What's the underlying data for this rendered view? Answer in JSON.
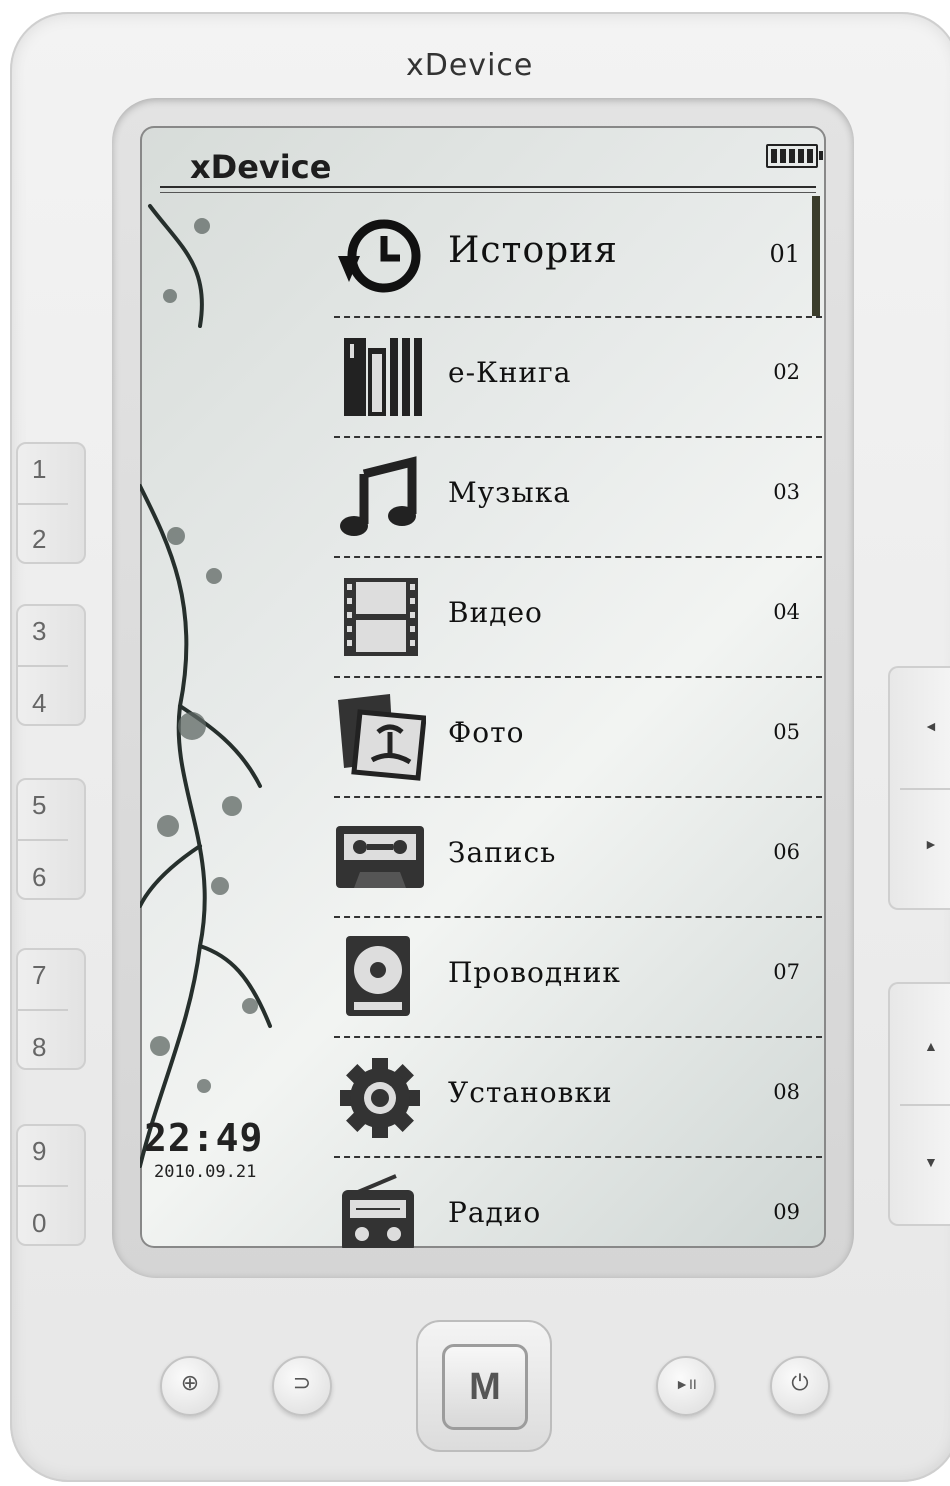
{
  "device": {
    "brand": "xDevice"
  },
  "status": {
    "brand": "xDevice",
    "battery": "battery-full-icon"
  },
  "clock": {
    "time": "22:49",
    "date": "2010.09.21"
  },
  "menu": [
    {
      "label": "История",
      "num": "01",
      "icon": "history-icon"
    },
    {
      "label": "e-Книга",
      "num": "02",
      "icon": "books-icon"
    },
    {
      "label": "Музыка",
      "num": "03",
      "icon": "music-note-icon"
    },
    {
      "label": "Видео",
      "num": "04",
      "icon": "film-icon"
    },
    {
      "label": "Фото",
      "num": "05",
      "icon": "photo-icon"
    },
    {
      "label": "Запись",
      "num": "06",
      "icon": "cassette-icon"
    },
    {
      "label": "Проводник",
      "num": "07",
      "icon": "disk-icon"
    },
    {
      "label": "Установки",
      "num": "08",
      "icon": "gear-icon"
    },
    {
      "label": "Радио",
      "num": "09",
      "icon": "radio-icon"
    }
  ],
  "keypad": [
    "1",
    "2",
    "3",
    "4",
    "5",
    "6",
    "7",
    "8",
    "9",
    "0"
  ],
  "nav": {
    "left": "◄",
    "right": "►",
    "up": "▲",
    "down": "▼"
  },
  "bottom": {
    "zoom": "⊕",
    "back": "⊃",
    "menu": "M",
    "play": "►II",
    "power": "⏻"
  }
}
